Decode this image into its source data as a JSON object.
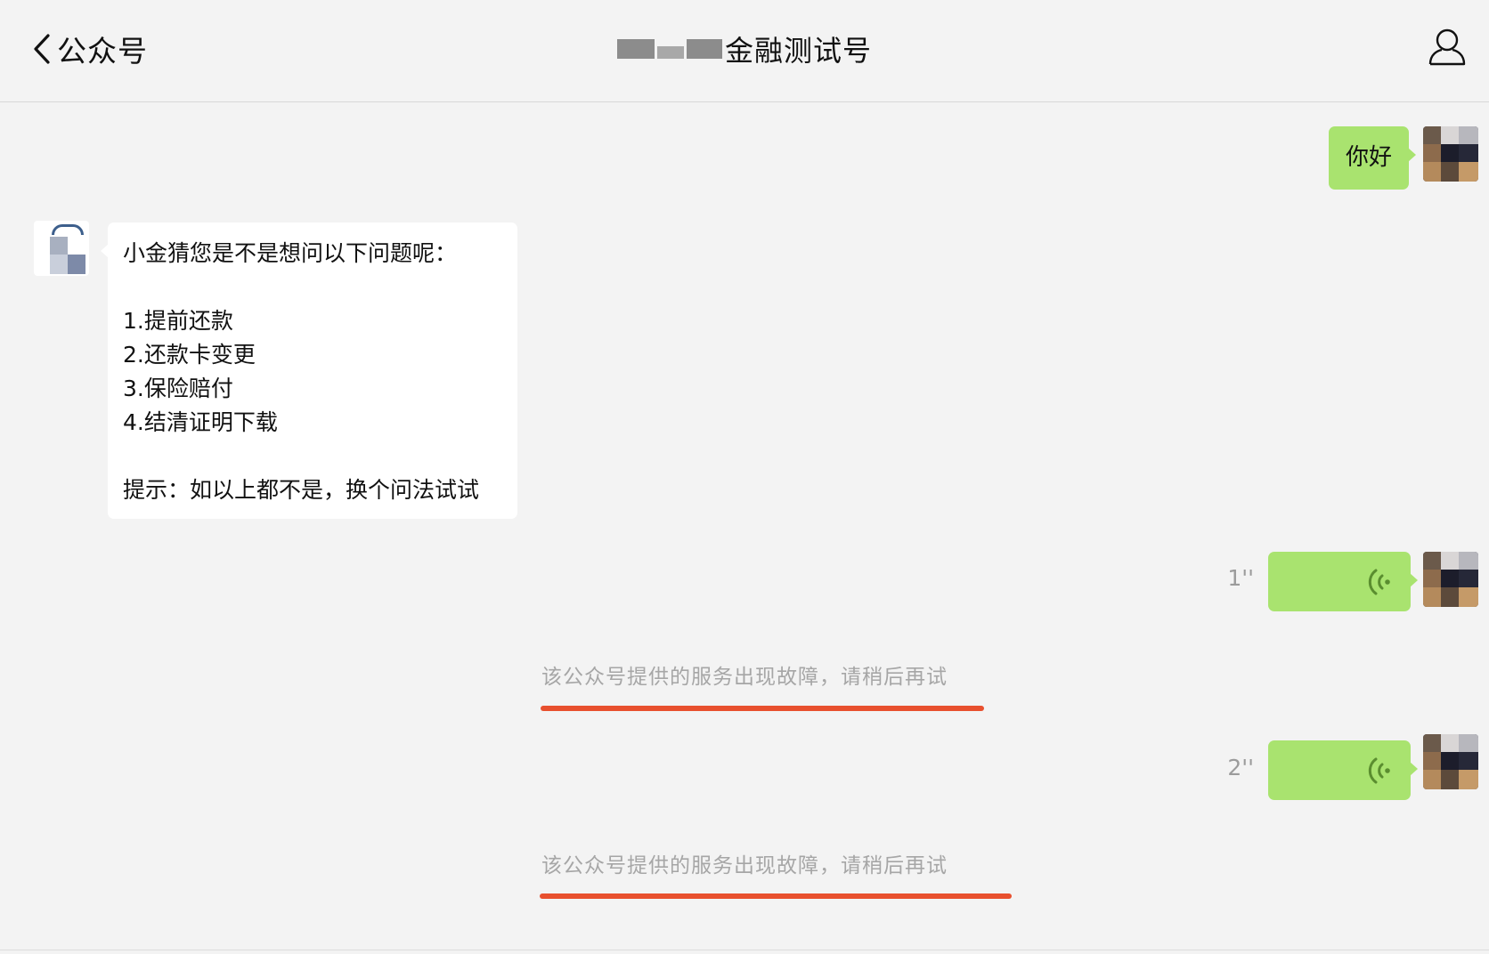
{
  "header": {
    "back_label": "公众号",
    "title": "金融测试号"
  },
  "messages": {
    "greeting": "你好",
    "bot_reply": "小金猜您是不是想问以下问题呢：\n\n1.提前还款\n2.还款卡变更\n3.保险赔付\n4.结清证明下载\n\n提示：如以上都不是，换个问法试试",
    "voice1_duration": "1''",
    "voice2_duration": "2''",
    "notice1": "该公众号提供的服务出现故障，请稍后再试",
    "notice2": "该公众号提供的服务出现故障，请稍后再试"
  },
  "icons": {
    "back": "chevron-left-icon",
    "profile": "person-outline-icon",
    "voice": "voice-wave-icon"
  },
  "colors": {
    "background": "#f3f3f3",
    "user_bubble": "#a9e36f",
    "bot_bubble": "#ffffff",
    "notice_text": "#a6a6a6",
    "annotation_underline": "#e8502e"
  }
}
